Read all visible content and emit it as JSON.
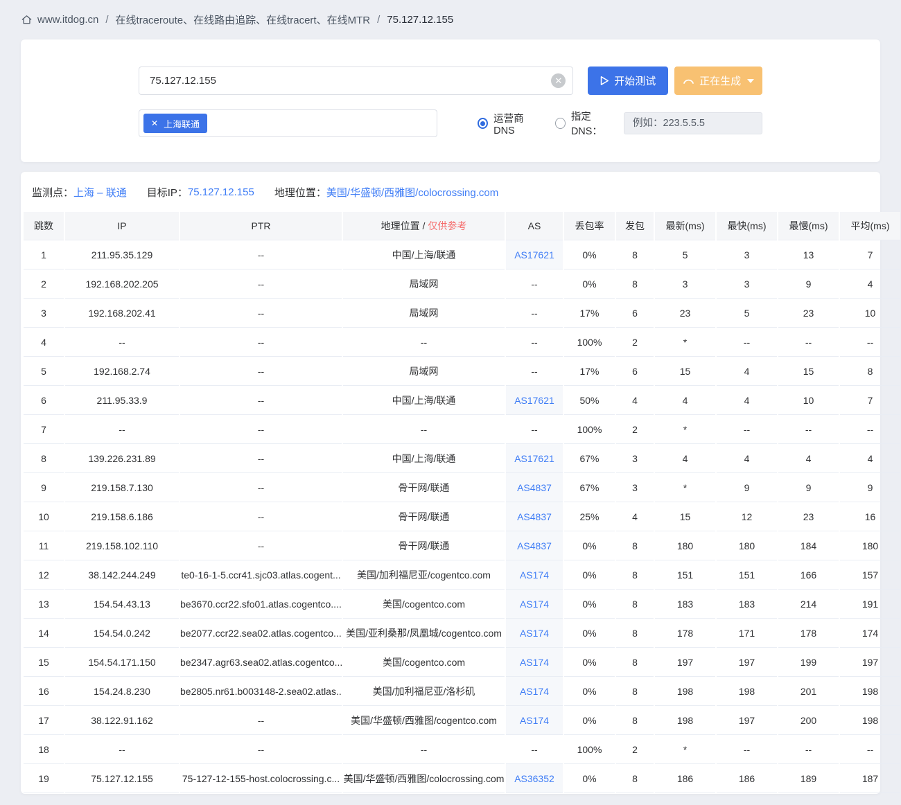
{
  "breadcrumb": {
    "site": "www.itdog.cn",
    "separator": "/",
    "page": "在线traceroute、在线路由追踪、在线tracert、在线MTR",
    "target": "75.127.12.155"
  },
  "controls": {
    "target_input_value": "75.127.12.155",
    "clear_glyph": "✕",
    "start_button": "开始测试",
    "generating_button": "正在生成",
    "node_tag": "上海联通",
    "tag_close_glyph": "✕",
    "dns_radio_isp": "运营商DNS",
    "dns_radio_custom": "指定DNS：",
    "dns_input_placeholder": "例如：223.5.5.5"
  },
  "result_info": {
    "monitor_label": "监测点：",
    "monitor_value": "上海 – 联通",
    "target_ip_label": "目标IP：",
    "target_ip_value": "75.127.12.155",
    "geo_label": "地理位置：",
    "geo_value": "美国/华盛顿/西雅图/colocrossing.com"
  },
  "table": {
    "headers": [
      "跳数",
      "IP",
      "PTR",
      "地理位置 /",
      "AS",
      "丢包率",
      "发包",
      "最新(ms)",
      "最快(ms)",
      "最慢(ms)",
      "平均(ms)"
    ],
    "header_note": "仅供参考",
    "rows": [
      {
        "hop": "1",
        "ip": "211.95.35.129",
        "ptr": "--",
        "geo": "中国/上海/联通",
        "as": "AS17621",
        "as_link": true,
        "loss": "0%",
        "sent": "8",
        "latest": "5",
        "fastest": "3",
        "slowest": "13",
        "avg": "7"
      },
      {
        "hop": "2",
        "ip": "192.168.202.205",
        "ptr": "--",
        "geo": "局域网",
        "as": "--",
        "as_link": false,
        "loss": "0%",
        "sent": "8",
        "latest": "3",
        "fastest": "3",
        "slowest": "9",
        "avg": "4"
      },
      {
        "hop": "3",
        "ip": "192.168.202.41",
        "ptr": "--",
        "geo": "局域网",
        "as": "--",
        "as_link": false,
        "loss": "17%",
        "sent": "6",
        "latest": "23",
        "fastest": "5",
        "slowest": "23",
        "avg": "10"
      },
      {
        "hop": "4",
        "ip": "--",
        "ptr": "--",
        "geo": "--",
        "as": "--",
        "as_link": false,
        "loss": "100%",
        "sent": "2",
        "latest": "*",
        "fastest": "--",
        "slowest": "--",
        "avg": "--"
      },
      {
        "hop": "5",
        "ip": "192.168.2.74",
        "ptr": "--",
        "geo": "局域网",
        "as": "--",
        "as_link": false,
        "loss": "17%",
        "sent": "6",
        "latest": "15",
        "fastest": "4",
        "slowest": "15",
        "avg": "8"
      },
      {
        "hop": "6",
        "ip": "211.95.33.9",
        "ptr": "--",
        "geo": "中国/上海/联通",
        "as": "AS17621",
        "as_link": true,
        "loss": "50%",
        "sent": "4",
        "latest": "4",
        "fastest": "4",
        "slowest": "10",
        "avg": "7"
      },
      {
        "hop": "7",
        "ip": "--",
        "ptr": "--",
        "geo": "--",
        "as": "--",
        "as_link": false,
        "loss": "100%",
        "sent": "2",
        "latest": "*",
        "fastest": "--",
        "slowest": "--",
        "avg": "--"
      },
      {
        "hop": "8",
        "ip": "139.226.231.89",
        "ptr": "--",
        "geo": "中国/上海/联通",
        "as": "AS17621",
        "as_link": true,
        "loss": "67%",
        "sent": "3",
        "latest": "4",
        "fastest": "4",
        "slowest": "4",
        "avg": "4"
      },
      {
        "hop": "9",
        "ip": "219.158.7.130",
        "ptr": "--",
        "geo": "骨干网/联通",
        "as": "AS4837",
        "as_link": true,
        "loss": "67%",
        "sent": "3",
        "latest": "*",
        "fastest": "9",
        "slowest": "9",
        "avg": "9"
      },
      {
        "hop": "10",
        "ip": "219.158.6.186",
        "ptr": "--",
        "geo": "骨干网/联通",
        "as": "AS4837",
        "as_link": true,
        "loss": "25%",
        "sent": "4",
        "latest": "15",
        "fastest": "12",
        "slowest": "23",
        "avg": "16"
      },
      {
        "hop": "11",
        "ip": "219.158.102.110",
        "ptr": "--",
        "geo": "骨干网/联通",
        "as": "AS4837",
        "as_link": true,
        "loss": "0%",
        "sent": "8",
        "latest": "180",
        "fastest": "180",
        "slowest": "184",
        "avg": "180"
      },
      {
        "hop": "12",
        "ip": "38.142.244.249",
        "ptr": "te0-16-1-5.ccr41.sjc03.atlas.cogent...",
        "geo": "美国/加利福尼亚/cogentco.com",
        "as": "AS174",
        "as_link": true,
        "loss": "0%",
        "sent": "8",
        "latest": "151",
        "fastest": "151",
        "slowest": "166",
        "avg": "157"
      },
      {
        "hop": "13",
        "ip": "154.54.43.13",
        "ptr": "be3670.ccr22.sfo01.atlas.cogentco....",
        "geo": "美国/cogentco.com",
        "as": "AS174",
        "as_link": true,
        "loss": "0%",
        "sent": "8",
        "latest": "183",
        "fastest": "183",
        "slowest": "214",
        "avg": "191"
      },
      {
        "hop": "14",
        "ip": "154.54.0.242",
        "ptr": "be2077.ccr22.sea02.atlas.cogentco....",
        "geo": "美国/亚利桑那/凤凰城/cogentco.com",
        "as": "AS174",
        "as_link": true,
        "loss": "0%",
        "sent": "8",
        "latest": "178",
        "fastest": "171",
        "slowest": "178",
        "avg": "174"
      },
      {
        "hop": "15",
        "ip": "154.54.171.150",
        "ptr": "be2347.agr63.sea02.atlas.cogentco....",
        "geo": "美国/cogentco.com",
        "as": "AS174",
        "as_link": true,
        "loss": "0%",
        "sent": "8",
        "latest": "197",
        "fastest": "197",
        "slowest": "199",
        "avg": "197"
      },
      {
        "hop": "16",
        "ip": "154.24.8.230",
        "ptr": "be2805.nr61.b003148-2.sea02.atlas...",
        "geo": "美国/加利福尼亚/洛杉矶",
        "as": "AS174",
        "as_link": true,
        "loss": "0%",
        "sent": "8",
        "latest": "198",
        "fastest": "198",
        "slowest": "201",
        "avg": "198"
      },
      {
        "hop": "17",
        "ip": "38.122.91.162",
        "ptr": "--",
        "geo": "美国/华盛顿/西雅图/cogentco.com",
        "as": "AS174",
        "as_link": true,
        "loss": "0%",
        "sent": "8",
        "latest": "198",
        "fastest": "197",
        "slowest": "200",
        "avg": "198"
      },
      {
        "hop": "18",
        "ip": "--",
        "ptr": "--",
        "geo": "--",
        "as": "--",
        "as_link": false,
        "loss": "100%",
        "sent": "2",
        "latest": "*",
        "fastest": "--",
        "slowest": "--",
        "avg": "--"
      },
      {
        "hop": "19",
        "ip": "75.127.12.155",
        "ptr": "75-127-12-155-host.colocrossing.c...",
        "geo": "美国/华盛顿/西雅图/colocrossing.com",
        "as": "AS36352",
        "as_link": true,
        "loss": "0%",
        "sent": "8",
        "latest": "186",
        "fastest": "186",
        "slowest": "189",
        "avg": "187"
      }
    ]
  },
  "colors": {
    "accent_blue": "#3c73e8",
    "link_blue": "#3f7df6",
    "generating_orange": "#f8c172",
    "note_red": "#f56c6c",
    "page_background": "#eceef3"
  }
}
